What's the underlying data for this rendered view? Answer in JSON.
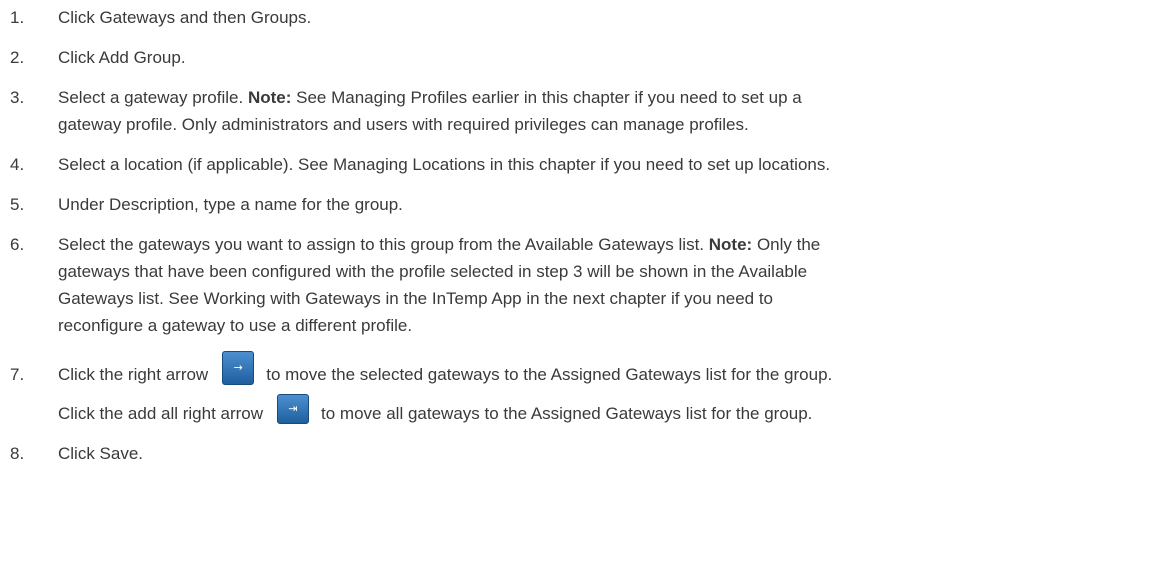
{
  "steps": [
    {
      "num": "1.",
      "text": "Click Gateways and then Groups."
    },
    {
      "num": "2.",
      "text": "Click Add Group."
    },
    {
      "num": "3.",
      "pre": "Select a gateway profile. ",
      "note_label": "Note:",
      "line1_rest": " See Managing Profiles earlier in this chapter if you need to set up a",
      "line2": "gateway profile. Only administrators and users with required privileges can manage profiles."
    },
    {
      "num": "4.",
      "text": "Select a location (if applicable). See Managing Locations in this chapter if you need to set up locations."
    },
    {
      "num": "5.",
      "text": "Under Description, type a name for the group."
    },
    {
      "num": "6.",
      "pre": "Select the gateways you want to assign to this group from the Available Gateways list. ",
      "note_label": "Note:",
      "line1_rest": " Only the",
      "line2": "gateways that have been configured with the profile selected in step 3 will be shown in the Available",
      "line3": "Gateways list. See Working with Gateways in the InTemp App in the next chapter if you need to",
      "line4": "reconfigure a gateway to use a different profile."
    },
    {
      "num": "7.",
      "line1_pre": "Click the right arrow",
      "line1_post": "to move the selected gateways to the Assigned Gateways list for the group.",
      "line2_pre": "Click the add all right arrow",
      "line2_post": "to move all gateways to the Assigned Gateways list for the group.",
      "icons": {
        "move_right": "→",
        "move_all_right": "⇥"
      },
      "button_color": "#2a6fb5"
    },
    {
      "num": "8.",
      "text": "Click Save."
    }
  ]
}
